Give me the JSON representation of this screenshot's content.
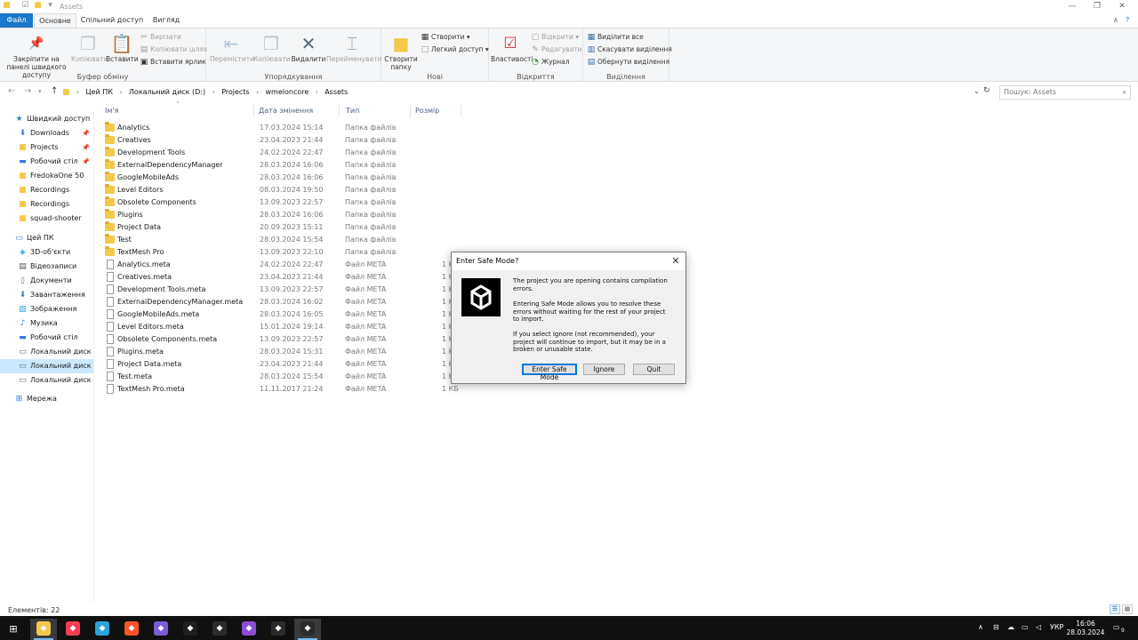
{
  "window": {
    "title": "Assets",
    "controls": {
      "minimize": "—",
      "maximize": "❐",
      "close": "✕"
    }
  },
  "tabs": {
    "file": "Файл",
    "home": "Основне",
    "share": "Спільний доступ",
    "view": "Вигляд"
  },
  "ribbon": {
    "clipboard": {
      "name": "Буфер обміну",
      "pin": "Закріпити на панелі швидкого доступу",
      "copy": "Копіювати",
      "paste": "Вставити",
      "cut": "Вирізати",
      "copy_path": "Копіювати шлях",
      "paste_shortcut": "Вставити ярлик"
    },
    "organize": {
      "name": "Упорядкування",
      "move_to": "Перемістити",
      "copy_to": "Копіювати",
      "delete": "Видалити",
      "rename": "Перейменувати"
    },
    "new": {
      "name": "Нові",
      "new_folder": "Створити папку",
      "new_item": "Створити",
      "easy_access": "Легкий доступ"
    },
    "open": {
      "name": "Відкриття",
      "properties": "Властивості",
      "open": "Відкрити",
      "edit": "Редагувати",
      "history": "Журнал"
    },
    "select": {
      "name": "Виділення",
      "select_all": "Виділити все",
      "select_none": "Скасувати виділення",
      "invert": "Обернути виділення"
    }
  },
  "address": {
    "crumbs": [
      "Цей ПК",
      "Локальний диск (D:)",
      "Projects",
      "wmeloncore",
      "Assets"
    ],
    "search_placeholder": "Пошук: Assets"
  },
  "nav": {
    "quick_access": "Швидкий доступ",
    "items": [
      "Downloads",
      "Projects",
      "Робочий стіл",
      "FredokaOne 50",
      "Recordings",
      "Recordings",
      "squad-shooter"
    ],
    "this_pc": "Цей ПК",
    "pc_items": [
      "3D-об'єкти",
      "Відеозаписи",
      "Документи",
      "Завантаження",
      "Зображення",
      "Музика",
      "Робочий стіл",
      "Локальний диск (C",
      "Локальний диск (D",
      "Локальний диск (E"
    ],
    "network": "Мережа"
  },
  "columns": {
    "name": "Ім'я",
    "date": "Дата змінення",
    "type": "Тип",
    "size": "Розмір"
  },
  "files": [
    {
      "name": "Analytics",
      "date": "17.03.2024 15:14",
      "type": "Папка файлів",
      "size": "",
      "kind": "folder"
    },
    {
      "name": "Creatives",
      "date": "23.04.2023 21:44",
      "type": "Папка файлів",
      "size": "",
      "kind": "folder"
    },
    {
      "name": "Development Tools",
      "date": "24.02.2024 22:47",
      "type": "Папка файлів",
      "size": "",
      "kind": "folder"
    },
    {
      "name": "ExternalDependencyManager",
      "date": "28.03.2024 16:06",
      "type": "Папка файлів",
      "size": "",
      "kind": "folder"
    },
    {
      "name": "GoogleMobileAds",
      "date": "28.03.2024 16:06",
      "type": "Папка файлів",
      "size": "",
      "kind": "folder"
    },
    {
      "name": "Level Editors",
      "date": "08.03.2024 19:50",
      "type": "Папка файлів",
      "size": "",
      "kind": "folder"
    },
    {
      "name": "Obsolete Components",
      "date": "13.09.2023 22:57",
      "type": "Папка файлів",
      "size": "",
      "kind": "folder"
    },
    {
      "name": "Plugins",
      "date": "28.03.2024 16:06",
      "type": "Папка файлів",
      "size": "",
      "kind": "folder"
    },
    {
      "name": "Project Data",
      "date": "20.09.2023 15:11",
      "type": "Папка файлів",
      "size": "",
      "kind": "folder"
    },
    {
      "name": "Test",
      "date": "28.03.2024 15:54",
      "type": "Папка файлів",
      "size": "",
      "kind": "folder"
    },
    {
      "name": "TextMesh Pro",
      "date": "13.09.2023 22:10",
      "type": "Папка файлів",
      "size": "",
      "kind": "folder"
    },
    {
      "name": "Analytics.meta",
      "date": "24.02.2024 22:47",
      "type": "Файл META",
      "size": "1 К",
      "kind": "file"
    },
    {
      "name": "Creatives.meta",
      "date": "23.04.2023 21:44",
      "type": "Файл META",
      "size": "1 К",
      "kind": "file"
    },
    {
      "name": "Development Tools.meta",
      "date": "13.09.2023 22:57",
      "type": "Файл META",
      "size": "1 К",
      "kind": "file"
    },
    {
      "name": "ExternalDependencyManager.meta",
      "date": "28.03.2024 16:02",
      "type": "Файл META",
      "size": "1 К",
      "kind": "file"
    },
    {
      "name": "GoogleMobileAds.meta",
      "date": "28.03.2024 16:05",
      "type": "Файл META",
      "size": "1 К",
      "kind": "file"
    },
    {
      "name": "Level Editors.meta",
      "date": "15.01.2024 19:14",
      "type": "Файл META",
      "size": "1 К",
      "kind": "file"
    },
    {
      "name": "Obsolete Components.meta",
      "date": "13.09.2023 22:57",
      "type": "Файл META",
      "size": "1 К",
      "kind": "file"
    },
    {
      "name": "Plugins.meta",
      "date": "28.03.2024 15:31",
      "type": "Файл META",
      "size": "1 К",
      "kind": "file"
    },
    {
      "name": "Project Data.meta",
      "date": "23.04.2023 21:44",
      "type": "Файл META",
      "size": "1 К",
      "kind": "file"
    },
    {
      "name": "Test.meta",
      "date": "28.03.2024 15:54",
      "type": "Файл META",
      "size": "1 К",
      "kind": "file"
    },
    {
      "name": "TextMesh Pro.meta",
      "date": "11.11.2017 21:24",
      "type": "Файл META",
      "size": "1 КБ",
      "kind": "file"
    }
  ],
  "status": {
    "count": "Елементів: 22"
  },
  "dialog": {
    "title": "Enter Safe Mode?",
    "p1": "The project you are opening contains compilation errors.",
    "p2": "Entering Safe Mode allows you to resolve these errors without waiting for the rest of your project to import.",
    "p3": "If you select Ignore (not recommended), your project will continue to import, but it may be in a broken or unusable state.",
    "btn_safe": "Enter Safe Mode",
    "btn_ignore": "Ignore",
    "btn_quit": "Quit"
  },
  "taskbar": {
    "lang": "УКР",
    "time": "16:06",
    "date": "28.03.2024",
    "notif_count": "9",
    "apps": [
      {
        "name": "file-explorer",
        "color": "#f3c94c",
        "active": true
      },
      {
        "name": "music-app",
        "color": "#fa3c55"
      },
      {
        "name": "telegram",
        "color": "#2aa3de"
      },
      {
        "name": "brave-browser",
        "color": "#fb542b"
      },
      {
        "name": "discord-like",
        "color": "#7b5cd6"
      },
      {
        "name": "code-editor",
        "color": "#1e1e1e"
      },
      {
        "name": "clock-app",
        "color": "#2b2b2b"
      },
      {
        "name": "visual-studio",
        "color": "#8a4dd4"
      },
      {
        "name": "unity-hub",
        "color": "#2b2b2b"
      },
      {
        "name": "unity-editor",
        "color": "#2b2b2b",
        "active": true
      }
    ]
  }
}
